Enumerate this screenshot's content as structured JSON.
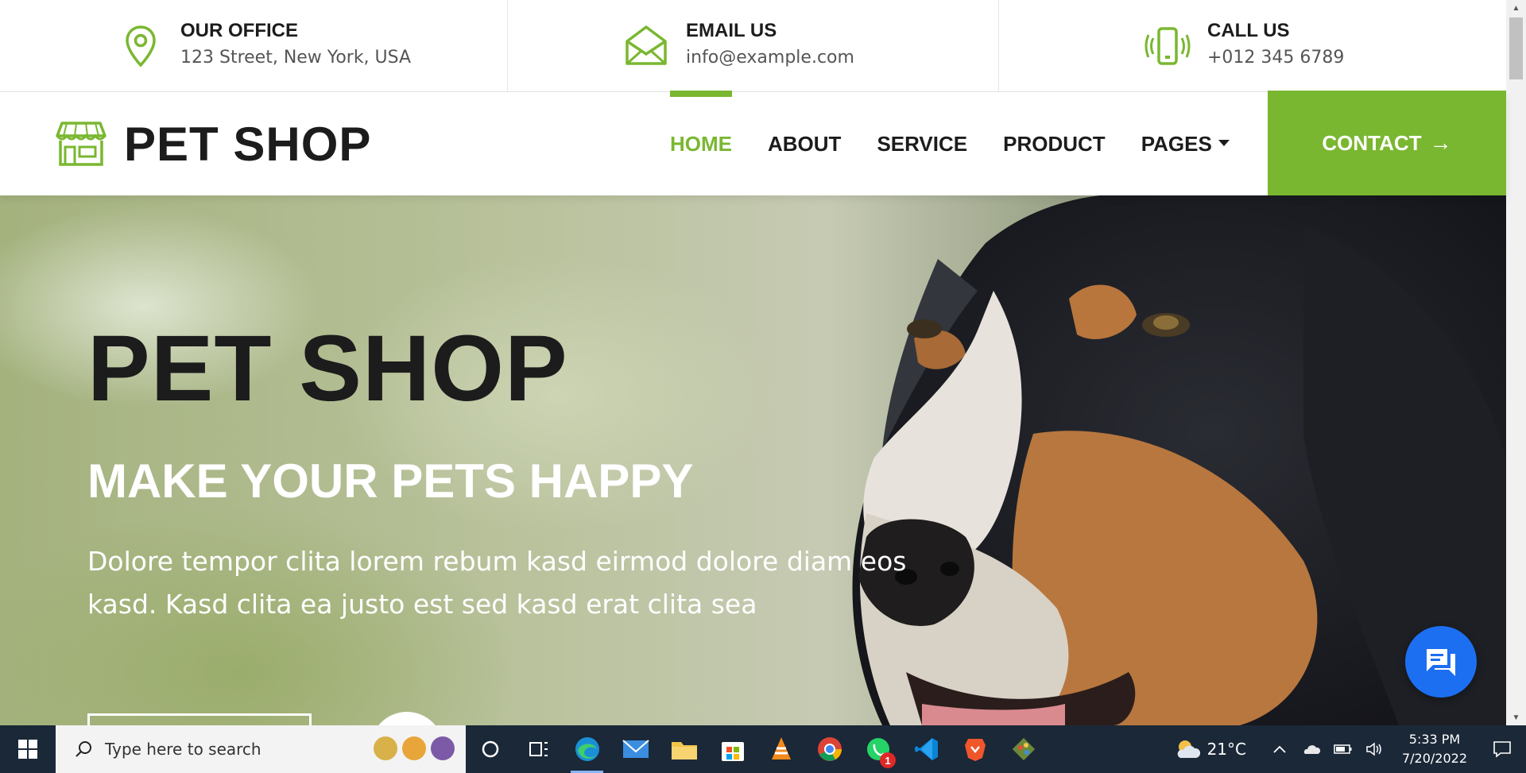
{
  "topbar": {
    "items": [
      {
        "title": "OUR OFFICE",
        "value": "123 Street, New York, USA",
        "icon": "map-pin-icon"
      },
      {
        "title": "EMAIL US",
        "value": "info@example.com",
        "icon": "envelope-icon"
      },
      {
        "title": "CALL US",
        "value": "+012 345 6789",
        "icon": "phone-vibrate-icon"
      }
    ]
  },
  "navbar": {
    "brand": "PET SHOP",
    "brand_icon": "storefront-icon",
    "menu": [
      "HOME",
      "ABOUT",
      "SERVICE",
      "PRODUCT",
      "PAGES"
    ],
    "active": "HOME",
    "contact_label": "CONTACT",
    "contact_arrow": "→"
  },
  "hero": {
    "title": "PET SHOP",
    "subtitle": "MAKE YOUR PETS HAPPY",
    "text": "Dolore tempor clita lorem rebum kasd eirmod dolore diam eos kasd. Kasd clita ea justo est sed kasd erat clita sea"
  },
  "colors": {
    "accent": "#7ab730",
    "dark": "#1c1c1c",
    "chat": "#1d6ff2",
    "taskbar": "#1b2838"
  },
  "taskbar": {
    "search_placeholder": "Type here to search",
    "apps": [
      "cortana-icon",
      "task-view-icon",
      "edge-icon",
      "mail-icon",
      "file-explorer-icon",
      "store-icon",
      "vlc-icon",
      "chrome-icon",
      "whatsapp-icon",
      "vscode-icon",
      "brave-icon",
      "git-icon"
    ],
    "whatsapp_badge": "1",
    "weather": "21°C",
    "time": "5:33 PM",
    "date": "7/20/2022"
  }
}
